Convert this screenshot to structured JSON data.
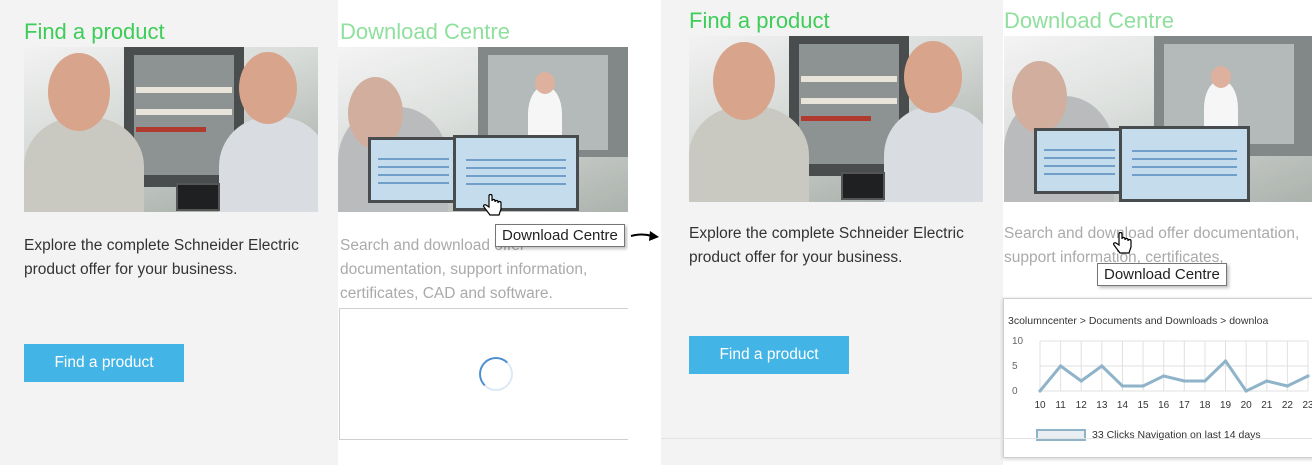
{
  "left": {
    "find_title": "Find a product",
    "find_text": "Explore the complete Schneider Electric product offer for your business.",
    "find_button": "Find a product",
    "dl_title": "Download Centre",
    "dl_text": "Search and download offer documentation, support information, certificates, CAD and software.",
    "tooltip": "Download Centre"
  },
  "right": {
    "find_title": "Find a product",
    "find_text": "Explore the complete Schneider Electric product offer for your business.",
    "find_button": "Find a product",
    "dl_title": "Download Centre",
    "dl_text": "Search and download offer documentation, support information, certificates,",
    "tooltip": "Download Centre"
  },
  "colors": {
    "title_green": "#3dcd58",
    "button_blue": "#42b4e6",
    "series": "#8fb3c9"
  },
  "chart_data": {
    "type": "line",
    "title": "3columncenter > Documents and Downloads > downloa",
    "x": [
      10,
      11,
      12,
      13,
      14,
      15,
      16,
      17,
      18,
      19,
      20,
      21,
      22,
      23
    ],
    "series": [
      {
        "name": "33 Clicks Navigation on last 14 days",
        "values": [
          0,
          5,
          2,
          5,
          1,
          1,
          3,
          2,
          2,
          6,
          0,
          2,
          1,
          3
        ]
      }
    ],
    "ylim": [
      0,
      10
    ],
    "yticks": [
      0,
      5,
      10
    ],
    "grid": true,
    "legend": "bottom"
  }
}
